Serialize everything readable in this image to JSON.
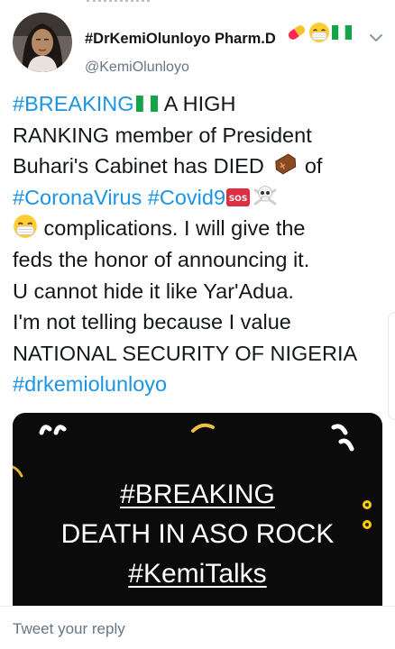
{
  "tweet": {
    "author": {
      "display_name": "#DrKemiOlunloyo Pharm.D",
      "handle": "@KemiOlunloyo",
      "name_emojis": [
        "pill-icon",
        "mask-face-icon",
        "nigeria-flag-icon"
      ]
    },
    "lines": [
      {
        "parts": [
          {
            "text": "#BREAKING",
            "tag": true
          },
          {
            "icon": "nigeria-flag-icon"
          },
          {
            "text": " A HIGH"
          }
        ]
      },
      {
        "parts": [
          {
            "text": "RANKING member of President"
          }
        ]
      },
      {
        "parts": [
          {
            "text": "Buhari's Cabinet has DIED "
          },
          {
            "icon": "coffin-icon"
          },
          {
            "text": " of"
          }
        ]
      },
      {
        "parts": [
          {
            "text": "#CoronaVirus",
            "tag": true
          },
          {
            "text": " "
          },
          {
            "text": "#Covid9",
            "tag": true
          },
          {
            "icon": "sos-icon"
          },
          {
            "icon": "skull-crossbones-icon"
          }
        ]
      },
      {
        "parts": [
          {
            "icon": "mask-face-icon"
          },
          {
            "text": " complications. I will give the"
          }
        ]
      },
      {
        "parts": [
          {
            "text": "feds the honor of announcing it."
          }
        ]
      },
      {
        "parts": [
          {
            "text": "U cannot hide it like Yar'Adua."
          }
        ]
      },
      {
        "parts": [
          {
            "text": "I'm not telling because I value"
          }
        ]
      },
      {
        "parts": [
          {
            "text": "NATIONAL SECURITY OF NIGERIA"
          }
        ]
      },
      {
        "parts": [
          {
            "text": "#drkemiolunloyo",
            "tag": true
          }
        ]
      }
    ],
    "colors": {
      "hashtag": "#1b95e0",
      "text": "#14171a",
      "muted": "#657786",
      "media_bg": "#0b0b0c"
    }
  },
  "media": {
    "line1": "#BREAKING",
    "line2": "DEATH IN ASO ROCK",
    "line3": "#KemiTalks"
  },
  "reply": {
    "placeholder": "Tweet your reply"
  }
}
